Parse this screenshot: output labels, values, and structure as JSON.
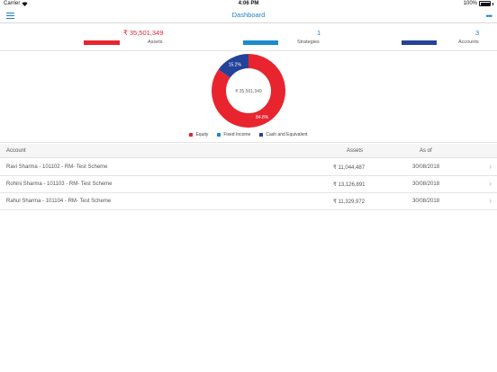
{
  "status_bar": {
    "carrier": "Carrier",
    "time": "4:06 PM",
    "battery": "100%"
  },
  "nav": {
    "title": "Dashboard"
  },
  "summary": {
    "assets_value": "₹ 35,501,349",
    "assets_label": "Assets",
    "strategies_value": "1",
    "strategies_label": "Strategies",
    "accounts_value": "3",
    "accounts_label": "Accounts"
  },
  "colors": {
    "equity": "#e8252f",
    "fixed_income": "#1a8ccc",
    "cash": "#25429a",
    "accent": "#1f7fc6"
  },
  "chart_data": {
    "type": "pie",
    "center_label": "₹ 35,501,349",
    "slices": [
      {
        "label": "Equity",
        "percent": 84.8,
        "percent_label": "84.8%",
        "color": "#e8252f"
      },
      {
        "label": "Fixed Income",
        "percent": 0.0,
        "percent_label": "",
        "color": "#1a8ccc"
      },
      {
        "label": "Cash and Equivalent",
        "percent": 15.2,
        "percent_label": "15.2%",
        "color": "#25429a"
      }
    ]
  },
  "table": {
    "headers": {
      "account": "Account",
      "assets": "Assets",
      "as_of": "As of"
    },
    "rows": [
      {
        "account": "Ravi Sharma - 101102 - RM- Test Scheme",
        "assets": "₹ 11,044,487",
        "as_of": "30/08/2018"
      },
      {
        "account": "Rohini Sharma - 101103 - RM- Test Scheme",
        "assets": "₹ 13,126,891",
        "as_of": "30/08/2018"
      },
      {
        "account": "Rahul Sharma - 101104 - RM- Test Scheme",
        "assets": "₹ 11,329,972",
        "as_of": "30/08/2018"
      }
    ]
  }
}
